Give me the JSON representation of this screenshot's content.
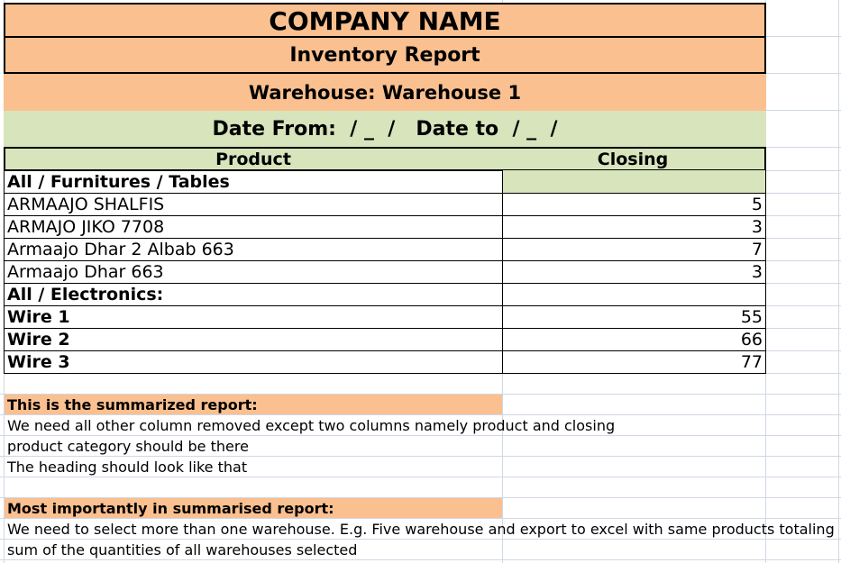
{
  "header": {
    "company_name": "COMPANY NAME",
    "report_title": "Inventory Report",
    "warehouse": "Warehouse: Warehouse 1",
    "date_range": "Date From:  / _  /   Date to  / _  /"
  },
  "table": {
    "columns": [
      "Product",
      "Closing"
    ],
    "rows": [
      {
        "product": "All / Furnitures / Tables",
        "closing": "",
        "type": "category"
      },
      {
        "product": "ARMAAJO SHALFIS",
        "closing": "5",
        "type": "item"
      },
      {
        "product": "ARMAJO JIKO 7708",
        "closing": "3",
        "type": "item"
      },
      {
        "product": "Armaajo Dhar 2 Albab 663",
        "closing": "7",
        "type": "item"
      },
      {
        "product": "Armaajo Dhar 663",
        "closing": "3",
        "type": "item"
      },
      {
        "product": "All / Electronics:",
        "closing": "",
        "type": "category"
      },
      {
        "product": "Wire 1",
        "closing": "55",
        "type": "bold-item"
      },
      {
        "product": "Wire 2",
        "closing": "66",
        "type": "bold-item"
      },
      {
        "product": "Wire 3",
        "closing": "77",
        "type": "bold-item"
      }
    ]
  },
  "notes": {
    "summary_heading": "This is the summarized report:",
    "summary_lines": [
      "We need all other column removed except two columns namely product and closing",
      "product category should be there",
      "The heading should look like that"
    ],
    "important_heading": "Most importantly in summarised report:",
    "important_lines": [
      "We need to select more than one warehouse. E.g. Five warehouse and export to excel with same products totaling",
      "sum of the quantities of all warehouses selected"
    ]
  },
  "colors": {
    "orange": "#fac090",
    "green": "#d8e4bc",
    "gridline": "#d0d7e5"
  }
}
